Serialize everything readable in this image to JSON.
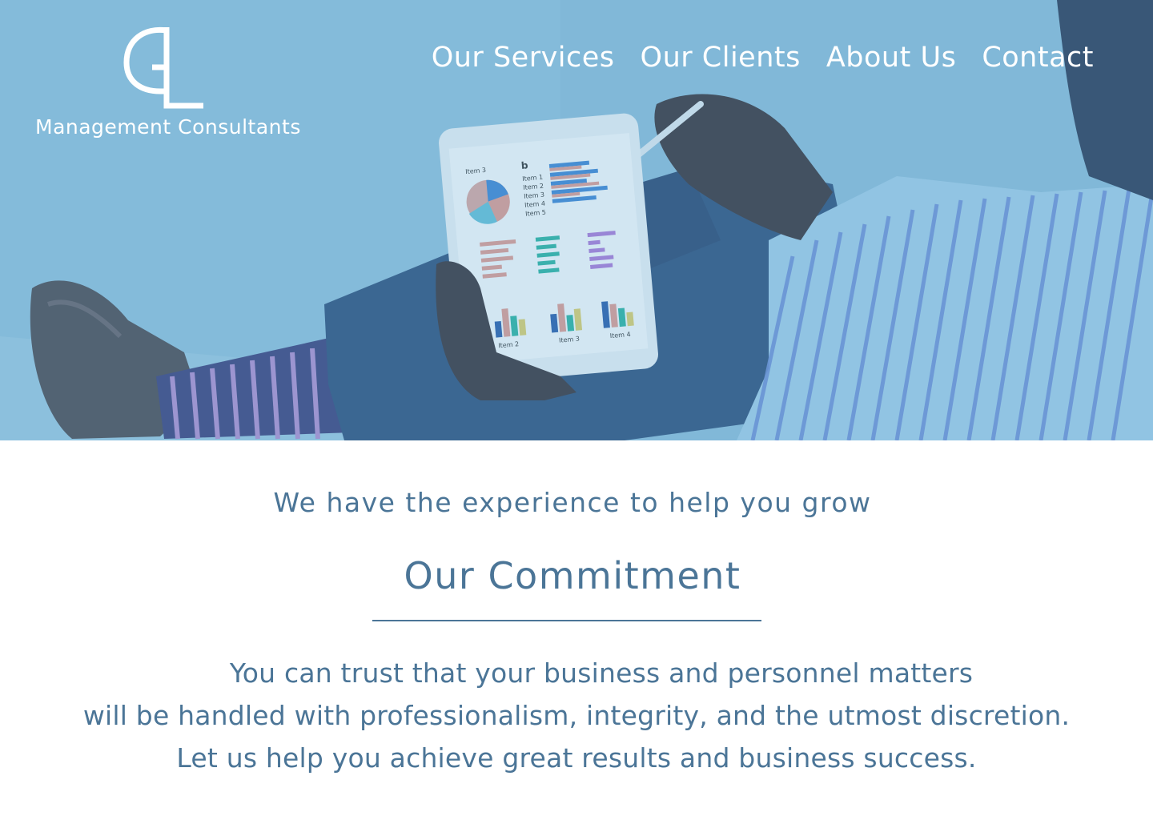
{
  "brand": {
    "logo_letters": "GL",
    "tagline": "Management Consultants"
  },
  "nav": {
    "items": [
      {
        "label": "Our Services"
      },
      {
        "label": "Our Clients"
      },
      {
        "label": "About Us"
      },
      {
        "label": "Contact"
      }
    ]
  },
  "hero": {
    "image_subject": "hero-photo",
    "tablet_labels": {
      "item3_top": "Item 3",
      "letter": "b",
      "item1": "Item 1",
      "item2": "Item 2",
      "item3": "Item 3",
      "item4": "Item 4",
      "item5": "Item 5",
      "bottom_item2": "Item 2",
      "bottom_item3": "Item 3",
      "bottom_item4": "Item 4"
    }
  },
  "main": {
    "lead": "We have the experience to help you grow",
    "heading": "Our Commitment",
    "lines": [
      "You can trust that your business and personnel matters",
      "will be handled with professionalism, integrity, and the utmost discretion.",
      "Let us help you achieve great results and business success."
    ]
  },
  "colors": {
    "accent": "#4b7597",
    "hero_tint": "#86b9d6",
    "nav_text": "#ffffff"
  }
}
